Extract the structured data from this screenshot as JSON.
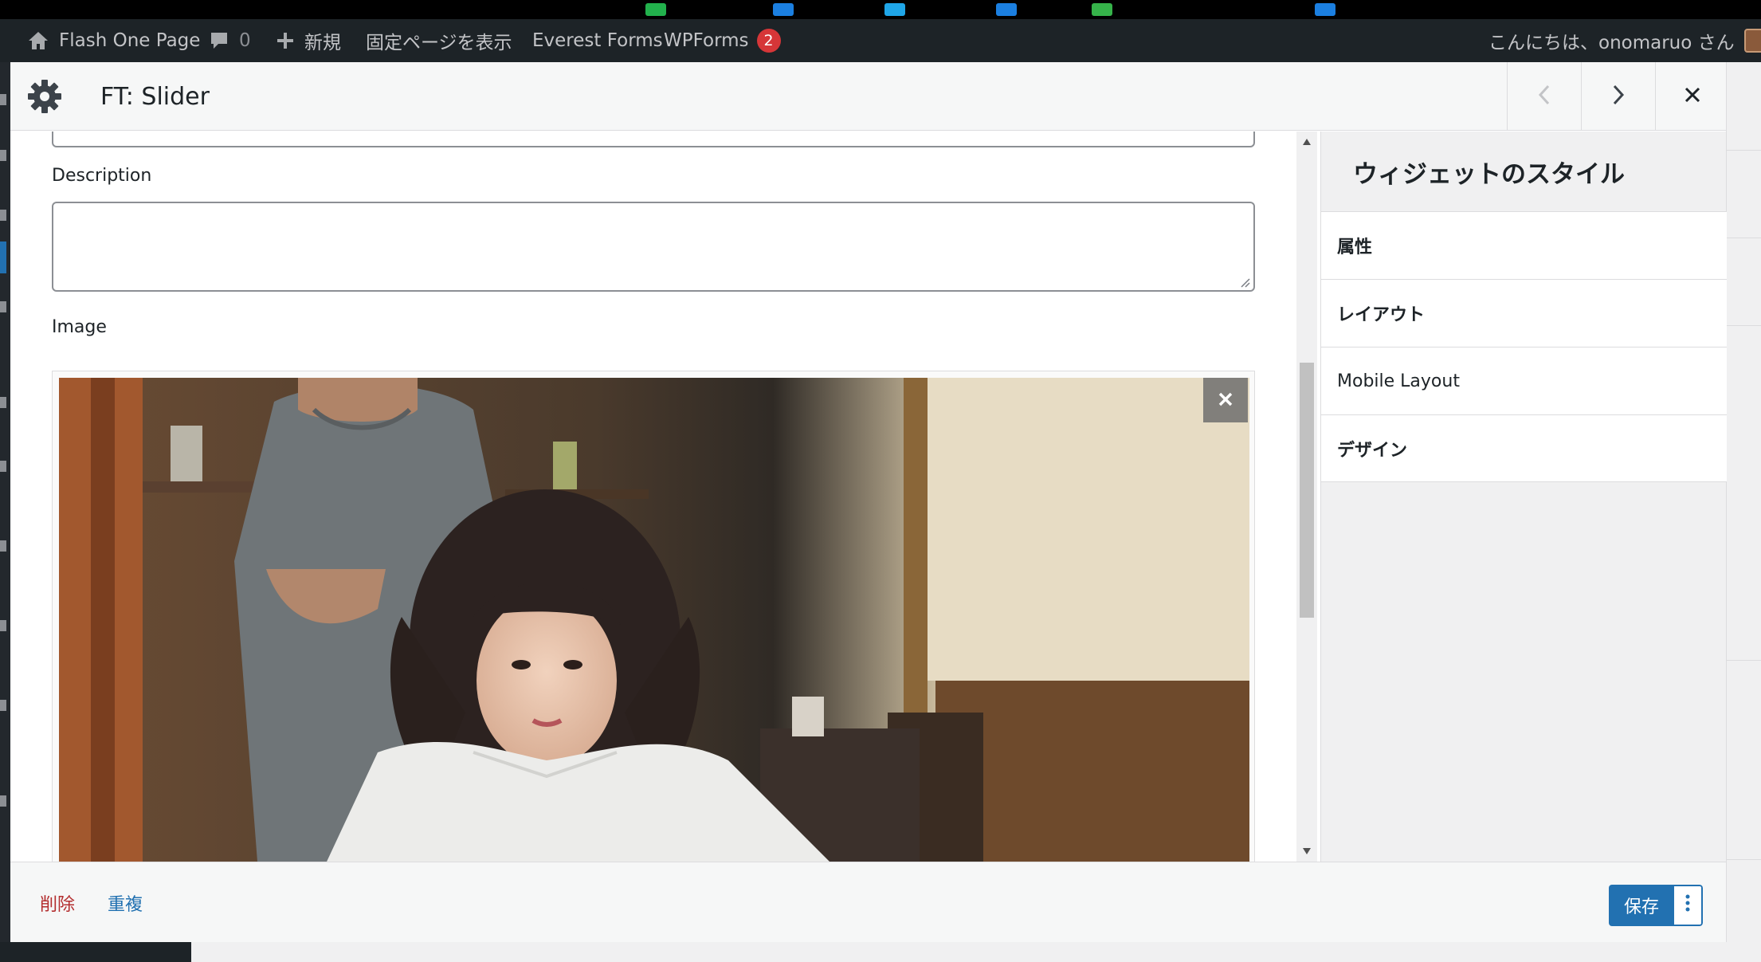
{
  "admin_bar": {
    "site_name": "Flash One Page",
    "comments_count": "0",
    "new_label": "新規",
    "view_page_label": "固定ページを表示",
    "everest_forms_label": "Everest Forms",
    "wpforms_label": "WPForms",
    "wpforms_badge": "2",
    "greeting": "こんにちは、onomaruo さん"
  },
  "modal": {
    "title": "FT: Slider",
    "fields": {
      "description_label": "Description",
      "description_value": "",
      "image_label": "Image"
    },
    "style_panel": {
      "heading": "ウィジェットのスタイル",
      "sections": [
        "属性",
        "レイアウト",
        "Mobile Layout",
        "デザイン"
      ]
    },
    "footer": {
      "delete_label": "削除",
      "duplicate_label": "重複",
      "save_label": "保存"
    }
  },
  "colors": {
    "wp_blue": "#2271b1",
    "delete_red": "#b32d2e",
    "admin_bar_bg": "#1d2327",
    "badge_red": "#d63638"
  },
  "icons": {
    "settings": "gear-icon",
    "prev": "chevron-left-icon",
    "next": "chevron-right-icon",
    "close": "close-icon",
    "remove_image": "close-icon",
    "more": "vertical-dots-icon"
  }
}
